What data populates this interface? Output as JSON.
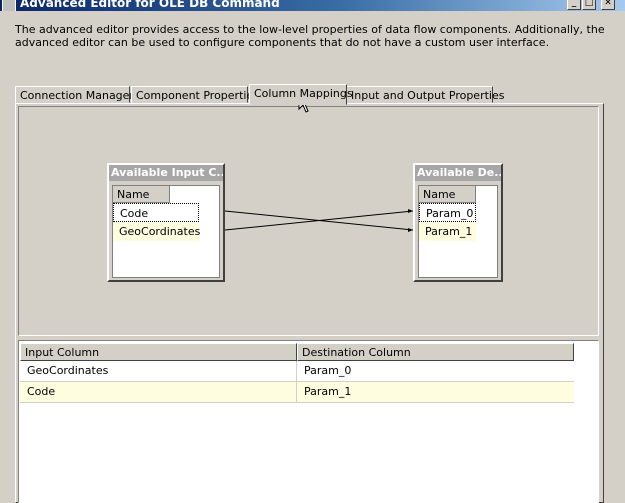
{
  "window": {
    "title": "Advanced Editor for OLE DB Command",
    "buttons": {
      "minimize": "_",
      "maximize": "□",
      "close": "✕"
    }
  },
  "description": "The advanced editor provides access to the low-level properties of data flow components. Additionally, the advanced editor can be used to configure components that do not have a custom user interface.",
  "tabs": [
    {
      "label": "Connection Managers"
    },
    {
      "label": "Component Properties"
    },
    {
      "label": "Column Mappings",
      "active": true
    },
    {
      "label": "Input and Output Properties"
    }
  ],
  "input_box": {
    "title": "Available Input C...",
    "header": "Name",
    "items": [
      "Code",
      "GeoCordinates"
    ]
  },
  "dest_box": {
    "title": "Available De...",
    "header": "Name",
    "items": [
      "Param_0",
      "Param_1"
    ]
  },
  "mappings": {
    "columns": [
      "Input Column",
      "Destination Column"
    ],
    "rows": [
      {
        "input": "GeoCordinates",
        "destination": "Param_0"
      },
      {
        "input": "Code",
        "destination": "Param_1"
      }
    ]
  },
  "colors": {
    "title_start": "#0a246a",
    "title_end": "#a6caf0",
    "face": "#d4d0c8",
    "row_highlight": "#fffde0"
  }
}
